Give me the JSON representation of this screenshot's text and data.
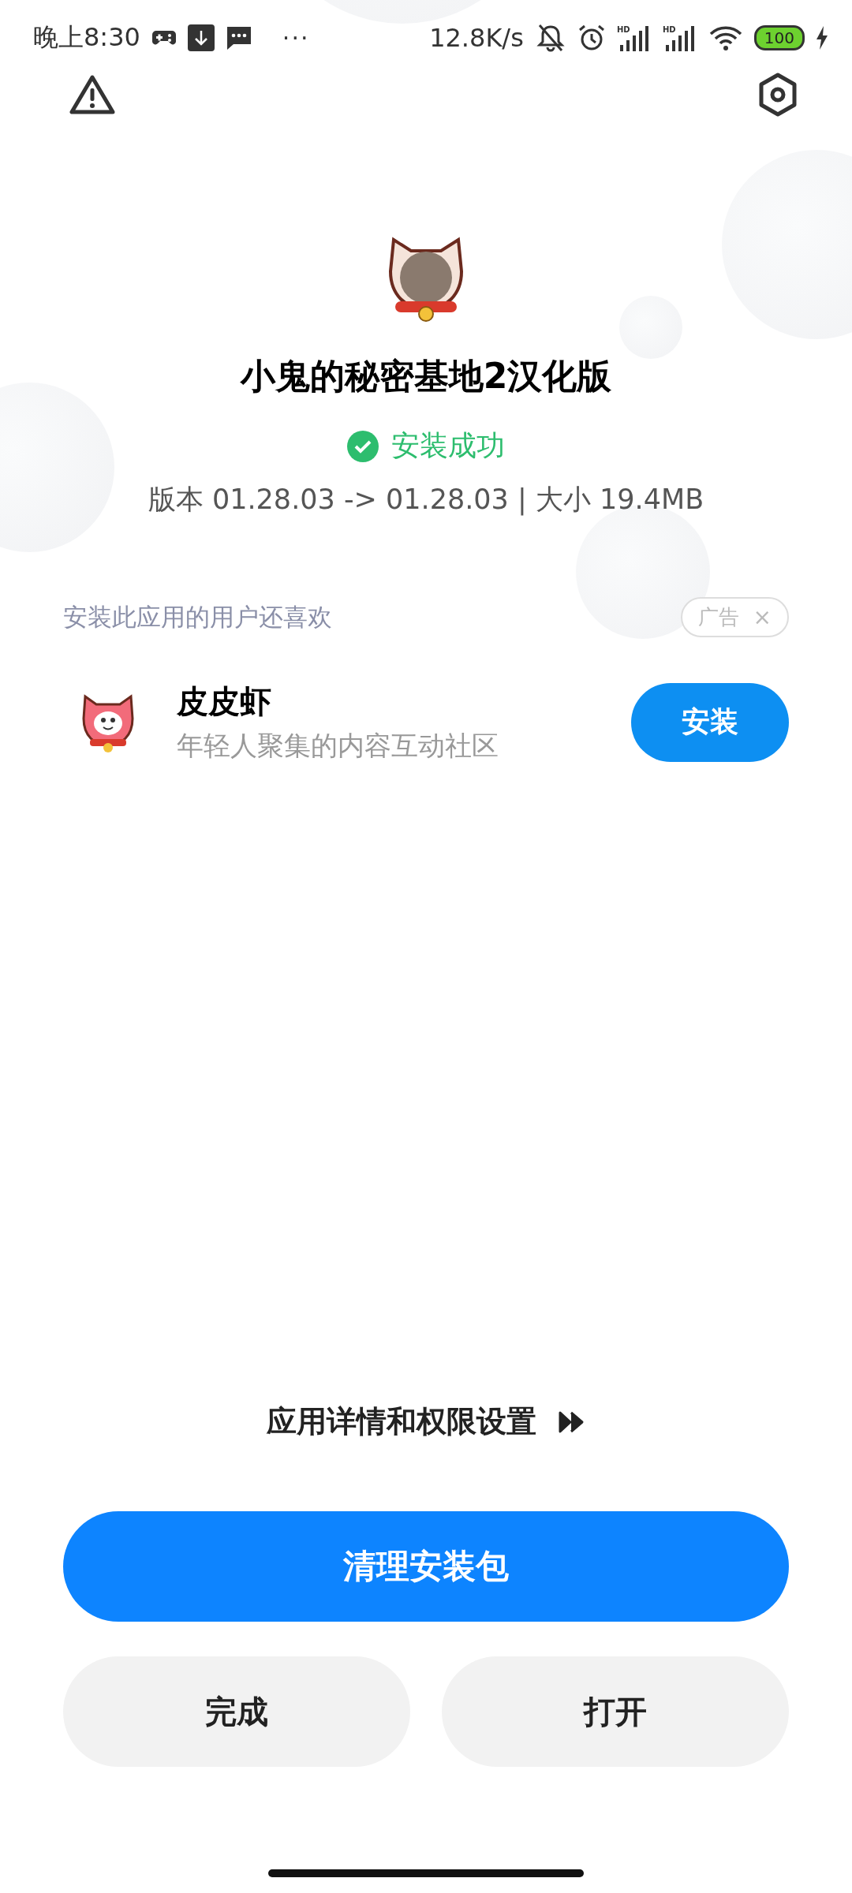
{
  "status_bar": {
    "time": "晚上8:30",
    "more": "···",
    "net_speed": "12.8K/s",
    "signals": [
      {
        "label": "HD"
      },
      {
        "label": "HD"
      }
    ],
    "battery": "100",
    "charging": true
  },
  "app": {
    "name": "小鬼的秘密基地2汉化版",
    "status": "安装成功",
    "info": "版本 01.28.03 -> 01.28.03 | 大小 19.4MB"
  },
  "recommend": {
    "title": "安装此应用的用户还喜欢",
    "ad_label": "广告",
    "ad_close": "×",
    "items": [
      {
        "name": "皮皮虾",
        "description": "年轻人聚集的内容互动社区",
        "button": "安装"
      }
    ]
  },
  "details_link": "应用详情和权限设置",
  "buttons": {
    "primary": "清理安装包",
    "left": "完成",
    "right": "打开"
  }
}
